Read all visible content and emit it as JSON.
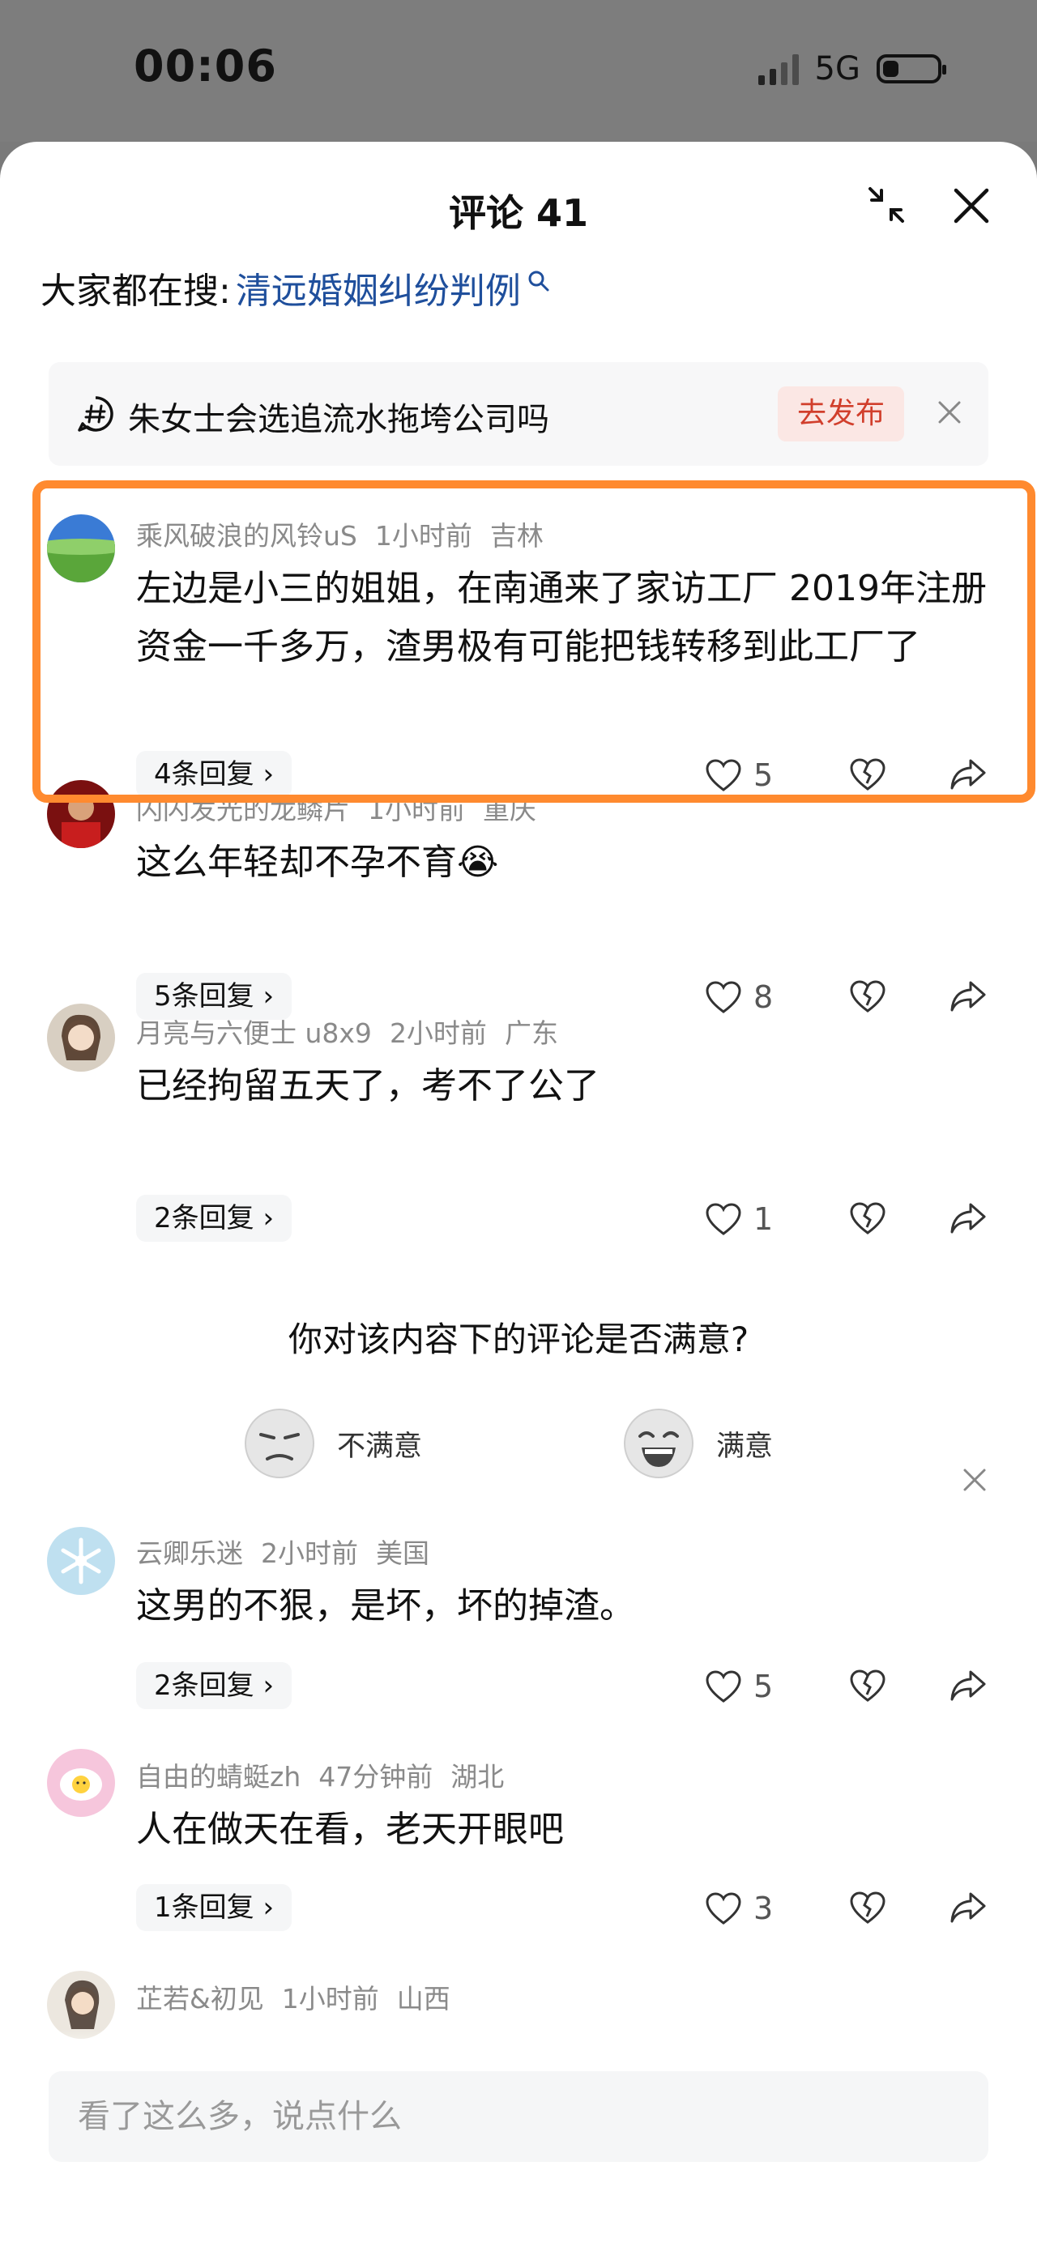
{
  "status_bar": {
    "time": "00:06",
    "network": "5G",
    "battery_level": 0.3
  },
  "header": {
    "title": "评论 41"
  },
  "hot_search": {
    "label": "大家都在搜:",
    "link": "清远婚姻纠纷判例"
  },
  "topic_banner": {
    "text": "朱女士会选追流水拖垮公司吗",
    "publish_label": "去发布"
  },
  "comments": [
    {
      "user": "乘风破浪的风铃uS",
      "time": "1小时前",
      "location": "吉林",
      "text": "左边是小三的姐姐，在南通来了家访工厂 2019年注册资金一千多万，渣男极有可能把钱转移到此工厂了",
      "replies": "4条回复",
      "likes": "5"
    },
    {
      "user": "闪闪发光的龙鳞片",
      "time": "1小时前",
      "location": "重庆",
      "text": "这么年轻却不孕不育😭",
      "replies": "5条回复",
      "likes": "8"
    },
    {
      "user": "月亮与六便士 u8x9",
      "time": "2小时前",
      "location": "广东",
      "text": "已经拘留五天了，考不了公了",
      "replies": "2条回复",
      "likes": "1"
    },
    {
      "user": "云卿乐迷",
      "time": "2小时前",
      "location": "美国",
      "text": "这男的不狠，是坏，坏的掉渣。",
      "replies": "2条回复",
      "likes": "5"
    },
    {
      "user": "自由的蜻蜓zh",
      "time": "47分钟前",
      "location": "湖北",
      "text": "人在做天在看，老天开眼吧",
      "replies": "1条回复",
      "likes": "3"
    },
    {
      "user": "芷若&初见",
      "time": "1小时前",
      "location": "山西"
    }
  ],
  "survey": {
    "question": "你对该内容下的评论是否满意?",
    "negative": "不满意",
    "positive": "满意"
  },
  "input": {
    "placeholder": "看了这么多，说点什么"
  },
  "colors": {
    "accent_link": "#1f4f9c",
    "publish": "#d13f2c",
    "highlight": "#ff8a2f"
  }
}
